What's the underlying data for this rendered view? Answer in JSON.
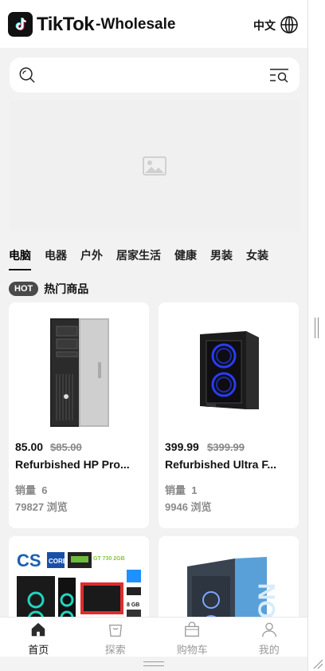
{
  "header": {
    "logo_text": "TikTok",
    "logo_suffix": "-Wholesale",
    "language": "中文",
    "globe_icon": "globe-icon",
    "logo_icon": "tiktok-note-icon"
  },
  "search": {
    "placeholder": "",
    "search_icon": "search-icon",
    "filter_icon": "filter-search-icon"
  },
  "banner": {
    "icon": "image-placeholder-icon"
  },
  "categories": [
    "电脑",
    "电器",
    "户外",
    "居家生活",
    "健康",
    "男装",
    "女装"
  ],
  "active_category_index": 0,
  "hot": {
    "badge": "HOT",
    "title": "热门商品"
  },
  "products": [
    {
      "price": "85.00",
      "original_price": "$85.00",
      "name": "Refurbished HP Pro...",
      "sales_label": "销量",
      "sales": "6",
      "views": "79827",
      "views_label": "浏览",
      "image": "tower-pc-silver-black"
    },
    {
      "price": "399.99",
      "original_price": "$399.99",
      "name": "Refurbished Ultra F...",
      "sales_label": "销量",
      "sales": "1",
      "views": "9946",
      "views_label": "浏览",
      "image": "gaming-case-blue-fans"
    },
    {
      "image": "gaming-pc-bundle",
      "badges": [
        "CS",
        "CORE",
        "GT 730 2GB",
        "8 GB"
      ]
    },
    {
      "image": "gaming-case-white-blue",
      "badges": [
        "ION"
      ]
    }
  ],
  "tabbar": [
    {
      "label": "首页",
      "icon": "home-icon",
      "active": true
    },
    {
      "label": "探索",
      "icon": "shopping-bag-icon",
      "active": false
    },
    {
      "label": "购物车",
      "icon": "cart-icon",
      "active": false
    },
    {
      "label": "我的",
      "icon": "user-icon",
      "active": false
    }
  ],
  "colors": {
    "background": "#f2f2f2",
    "card": "#ffffff",
    "hot_badge": "#4a4a4a",
    "muted_text": "#8a8a8a",
    "fan_blue": "#2a3cf0"
  }
}
